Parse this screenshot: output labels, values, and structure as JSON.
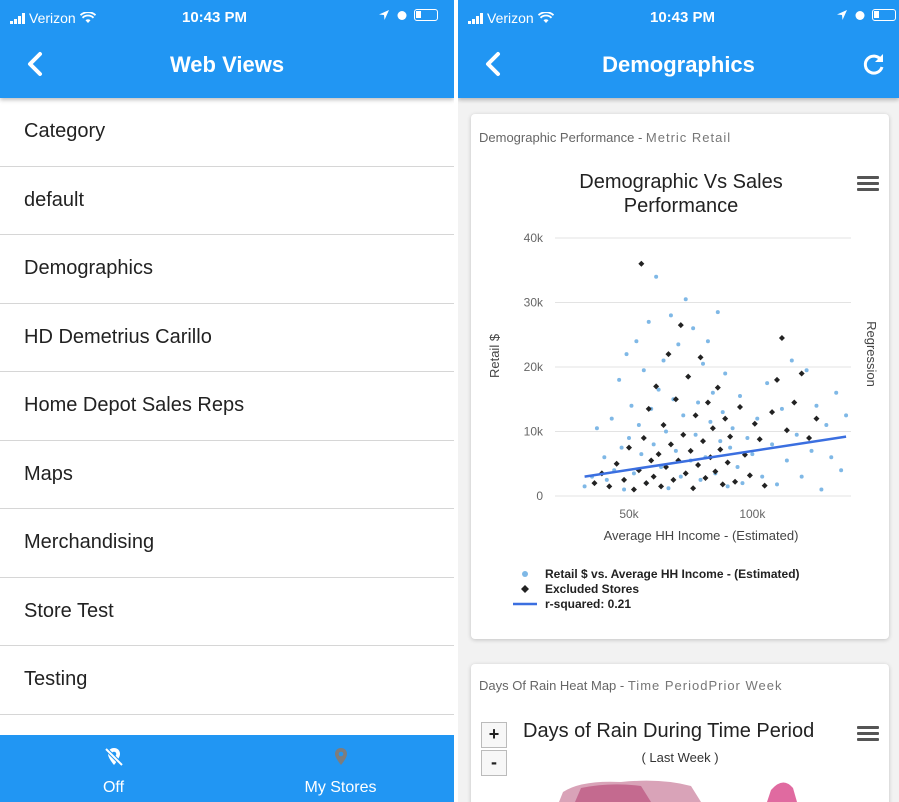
{
  "status_bar": {
    "carrier": "Verizon",
    "time": "10:43 PM"
  },
  "left_screen": {
    "title": "Web Views",
    "items": [
      "Category",
      "default",
      "Demographics",
      "HD Demetrius Carillo",
      "Home Depot Sales Reps",
      "Maps",
      "Merchandising",
      "Store Test",
      "Testing"
    ],
    "tabs": [
      {
        "label": "Off",
        "icon": "location-off-icon"
      },
      {
        "label": "My Stores",
        "icon": "location-pin-icon"
      }
    ]
  },
  "right_screen": {
    "title": "Demographics",
    "card1": {
      "header": "Demographic Performance -",
      "header_chip": "Metric Retail"
    },
    "card2": {
      "header": "Days Of Rain Heat Map -",
      "header_chip": "Time PeriodPrior Week",
      "chart_title": "Days of Rain During Time Period",
      "subtitle": "( Last Week )",
      "zoom_in": "+",
      "zoom_out": "-"
    }
  },
  "colors": {
    "primary": "#2196f3",
    "scatter_blue": "#7fb8e6",
    "excluded": "#222222",
    "regression": "#3b6fe0"
  },
  "chart_data": {
    "type": "scatter",
    "title": "Demographic Vs Sales Performance",
    "xlabel": "Average HH Income - (Estimated)",
    "ylabel": "Retail $",
    "y2label": "Regression",
    "xlim": [
      20000,
      140000
    ],
    "ylim": [
      0,
      40000
    ],
    "x_ticks": [
      {
        "value": 50000,
        "label": "50k"
      },
      {
        "value": 100000,
        "label": "100k"
      }
    ],
    "y_ticks": [
      {
        "value": 0,
        "label": "0"
      },
      {
        "value": 10000,
        "label": "10k"
      },
      {
        "value": 20000,
        "label": "20k"
      },
      {
        "value": 30000,
        "label": "30k"
      },
      {
        "value": 40000,
        "label": "40k"
      }
    ],
    "grid": true,
    "legend_position": "bottom",
    "series": [
      {
        "name": "Retail $ vs. Average HH Income - (Estimated)",
        "marker": "circle",
        "points": [
          [
            32000,
            1500
          ],
          [
            35000,
            3000
          ],
          [
            37000,
            10500
          ],
          [
            40000,
            6000
          ],
          [
            41000,
            2500
          ],
          [
            43000,
            12000
          ],
          [
            44000,
            4000
          ],
          [
            46000,
            18000
          ],
          [
            47000,
            7500
          ],
          [
            48000,
            1000
          ],
          [
            49000,
            22000
          ],
          [
            50000,
            9000
          ],
          [
            51000,
            14000
          ],
          [
            52000,
            3500
          ],
          [
            53000,
            24000
          ],
          [
            54000,
            11000
          ],
          [
            55000,
            6500
          ],
          [
            56000,
            19500
          ],
          [
            57000,
            2000
          ],
          [
            58000,
            27000
          ],
          [
            59000,
            13500
          ],
          [
            60000,
            8000
          ],
          [
            61000,
            34000
          ],
          [
            62000,
            16500
          ],
          [
            63000,
            4500
          ],
          [
            64000,
            21000
          ],
          [
            65000,
            10000
          ],
          [
            66000,
            1200
          ],
          [
            67000,
            28000
          ],
          [
            68000,
            15000
          ],
          [
            69000,
            7000
          ],
          [
            70000,
            23500
          ],
          [
            71000,
            3000
          ],
          [
            72000,
            12500
          ],
          [
            73000,
            30500
          ],
          [
            74000,
            18500
          ],
          [
            75000,
            5500
          ],
          [
            76000,
            26000
          ],
          [
            77000,
            9500
          ],
          [
            78000,
            14500
          ],
          [
            79000,
            2500
          ],
          [
            80000,
            20500
          ],
          [
            81000,
            6000
          ],
          [
            82000,
            24000
          ],
          [
            83000,
            11500
          ],
          [
            84000,
            16000
          ],
          [
            85000,
            3500
          ],
          [
            86000,
            28500
          ],
          [
            87000,
            8500
          ],
          [
            88000,
            13000
          ],
          [
            89000,
            19000
          ],
          [
            90000,
            1500
          ],
          [
            91000,
            7500
          ],
          [
            92000,
            10500
          ],
          [
            94000,
            4500
          ],
          [
            95000,
            15500
          ],
          [
            96000,
            2000
          ],
          [
            98000,
            9000
          ],
          [
            100000,
            6500
          ],
          [
            102000,
            12000
          ],
          [
            104000,
            3000
          ],
          [
            106000,
            17500
          ],
          [
            108000,
            8000
          ],
          [
            110000,
            1800
          ],
          [
            112000,
            13500
          ],
          [
            114000,
            5500
          ],
          [
            116000,
            21000
          ],
          [
            118000,
            9500
          ],
          [
            120000,
            3000
          ],
          [
            122000,
            19500
          ],
          [
            124000,
            7000
          ],
          [
            126000,
            14000
          ],
          [
            128000,
            1000
          ],
          [
            130000,
            11000
          ],
          [
            132000,
            6000
          ],
          [
            134000,
            16000
          ],
          [
            136000,
            4000
          ],
          [
            138000,
            12500
          ]
        ]
      },
      {
        "name": "Excluded Stores",
        "marker": "diamond",
        "points": [
          [
            36000,
            2000
          ],
          [
            39000,
            3500
          ],
          [
            42000,
            1500
          ],
          [
            45000,
            5000
          ],
          [
            48000,
            2500
          ],
          [
            50000,
            7500
          ],
          [
            52000,
            1000
          ],
          [
            54000,
            4000
          ],
          [
            55000,
            36000
          ],
          [
            56000,
            9000
          ],
          [
            57000,
            2000
          ],
          [
            58000,
            13500
          ],
          [
            59000,
            5500
          ],
          [
            60000,
            3000
          ],
          [
            61000,
            17000
          ],
          [
            62000,
            6500
          ],
          [
            63000,
            1500
          ],
          [
            64000,
            11000
          ],
          [
            65000,
            4500
          ],
          [
            66000,
            22000
          ],
          [
            67000,
            8000
          ],
          [
            68000,
            2500
          ],
          [
            69000,
            15000
          ],
          [
            70000,
            5500
          ],
          [
            71000,
            26500
          ],
          [
            72000,
            9500
          ],
          [
            73000,
            3500
          ],
          [
            74000,
            18500
          ],
          [
            75000,
            7000
          ],
          [
            76000,
            1200
          ],
          [
            77000,
            12500
          ],
          [
            78000,
            4800
          ],
          [
            79000,
            21500
          ],
          [
            80000,
            8500
          ],
          [
            81000,
            2800
          ],
          [
            82000,
            14500
          ],
          [
            83000,
            6000
          ],
          [
            84000,
            10500
          ],
          [
            85000,
            3800
          ],
          [
            86000,
            16800
          ],
          [
            87000,
            7200
          ],
          [
            88000,
            1800
          ],
          [
            89000,
            12000
          ],
          [
            90000,
            5200
          ],
          [
            91000,
            9200
          ],
          [
            93000,
            2200
          ],
          [
            95000,
            13800
          ],
          [
            97000,
            6400
          ],
          [
            99000,
            3200
          ],
          [
            101000,
            11200
          ],
          [
            103000,
            8800
          ],
          [
            105000,
            1600
          ],
          [
            108000,
            13000
          ],
          [
            110000,
            18000
          ],
          [
            112000,
            24500
          ],
          [
            114000,
            10200
          ],
          [
            117000,
            14500
          ],
          [
            120000,
            19000
          ],
          [
            123000,
            9000
          ],
          [
            126000,
            12000
          ]
        ]
      },
      {
        "name": "r-squared: 0.21",
        "type": "line",
        "points": [
          [
            32000,
            3000
          ],
          [
            138000,
            9200
          ]
        ]
      }
    ]
  }
}
